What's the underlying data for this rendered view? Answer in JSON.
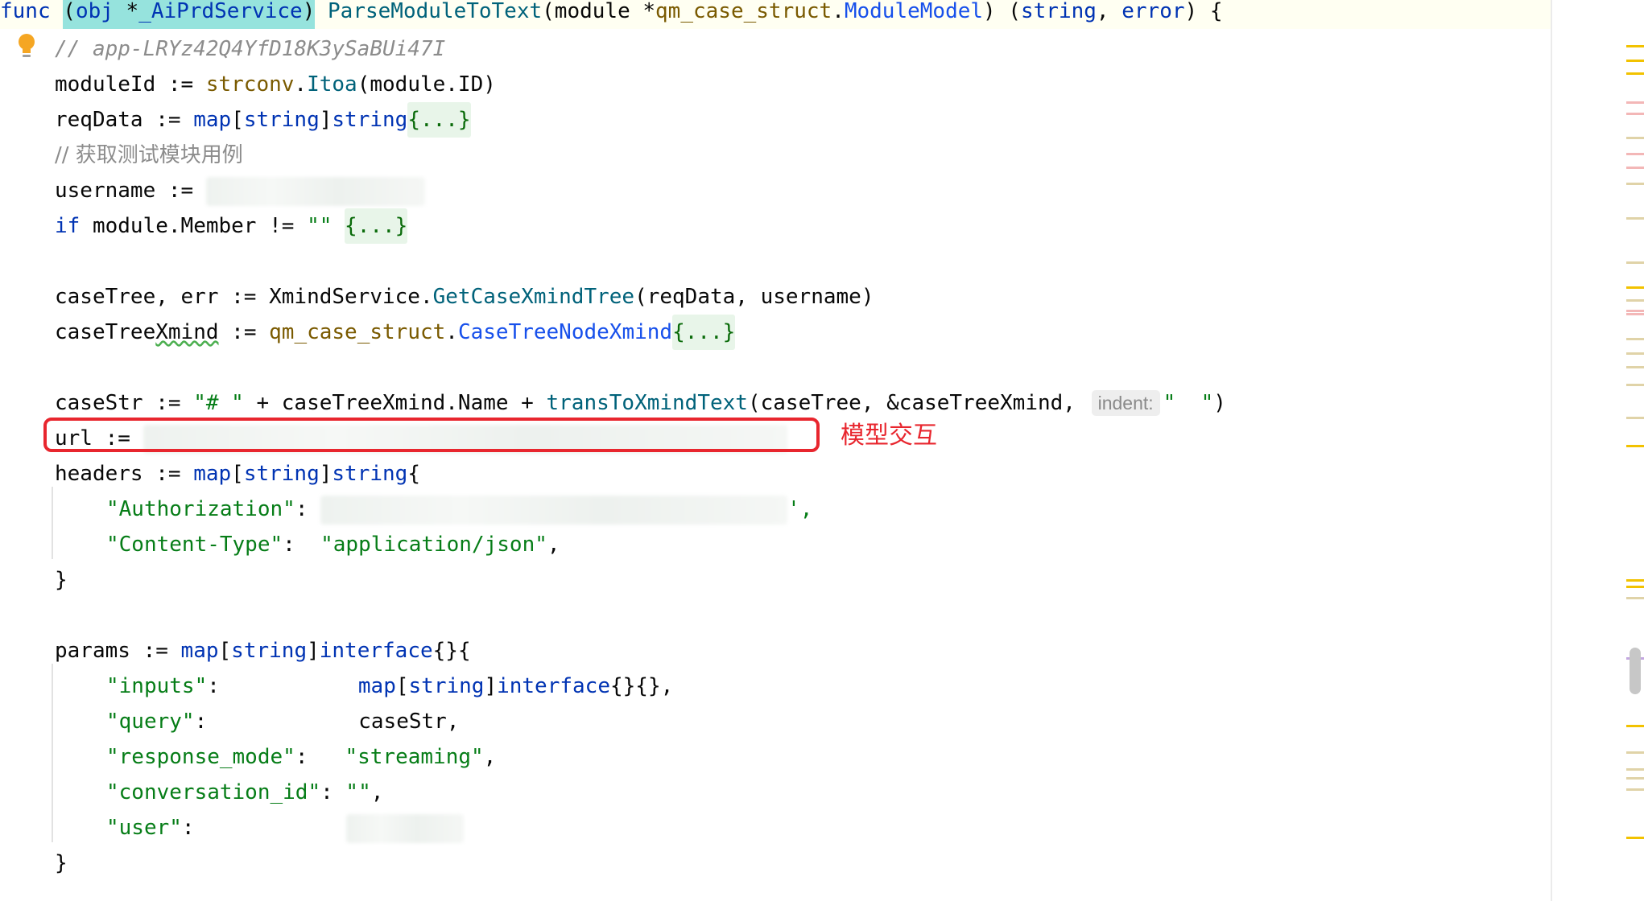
{
  "code": {
    "func_kw": "func",
    "receiver_name": "obj",
    "receiver_star": " *",
    "receiver_type": "_AiPrdService",
    "method_name": "ParseModuleToText",
    "param_name": "module ",
    "param_star": "*",
    "param_pkg": "qm_case_struct",
    "param_dot": ".",
    "param_type": "ModuleModel",
    "sig_rest_1": ") (",
    "ret_string": "string",
    "ret_comma": ", ",
    "ret_error": "error",
    "sig_end": ") {",
    "comment_app": "// app-LRYz42Q4YfD18K3ySaBUi47I",
    "moduleId_lhs": "moduleId := ",
    "strconv_pkg": "strconv",
    "strconv_dot": ".",
    "itoa_fn": "Itoa",
    "itoa_args": "(module.ID)",
    "reqData_lhs": "reqData := ",
    "map_kw": "map",
    "br_open": "[",
    "string_kw": "string",
    "br_close": "]",
    "fold_braces": "{...}",
    "comment_cn": "// 获取测试模块用例",
    "username_lhs": "username := ",
    "if_kw": "if",
    "if_cond": " module.Member != ",
    "empty_str": "\"\"",
    "caseTree_lhs": "caseTree, err := XmindService.",
    "getCase_fn": "GetCaseXmindTree",
    "getCase_args": "(reqData, username)",
    "ctx_lhs_1": "caseTree",
    "ctx_lhs_2": "Xmind",
    "ctx_assign": " := ",
    "ctx_type": "CaseTreeNodeXmind",
    "caseStr_lhs": "caseStr := ",
    "hash_str": "\"# \"",
    "caseStr_mid": " + caseTreeXmind.Name + ",
    "trans_fn": "transToXmindText",
    "trans_args": "(caseTree, &caseTreeXmind, ",
    "indent_hint": "indent:",
    "indent_val": "\"  \"",
    "close_paren": ")",
    "url_lhs": "url := ",
    "headers_lhs": "headers := ",
    "open_brace": "{",
    "auth_key": "\"Authorization\"",
    "colon": ": ",
    "trail_quote": "',",
    "ct_key": "\"Content-Type\"",
    "ct_val": "\"application/json\"",
    "comma": ",",
    "close_brace": "}",
    "params_lhs": "params := ",
    "interface_kw": "interface",
    "empty_braces": "{}",
    "inputs_key": "\"inputs\"",
    "inputs_tail": "{}{},",
    "query_key": "\"query\"",
    "query_val": "caseStr,",
    "resp_key": "\"response_mode\"",
    "resp_val": "\"streaming\"",
    "conv_key": "\"conversation_id\"",
    "user_key": "\"user\""
  },
  "annotation": {
    "label": "模型交互",
    "color": "#e8262e"
  },
  "icons": {
    "gutter": "lightbulb-icon"
  }
}
